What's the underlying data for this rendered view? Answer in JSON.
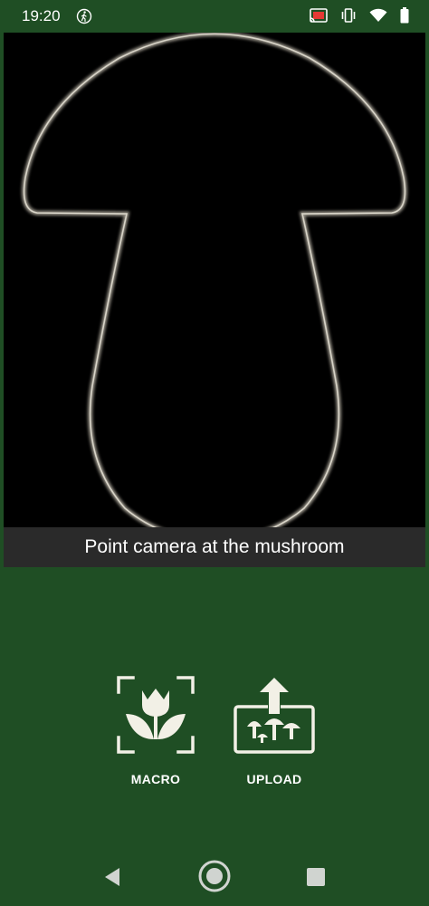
{
  "status_bar": {
    "time": "19:20",
    "icons": [
      "walk-icon",
      "cast-icon",
      "vibrate-icon",
      "wifi-icon",
      "battery-icon"
    ]
  },
  "camera": {
    "hint": "Point camera at the mushroom"
  },
  "actions": {
    "macro_label": "MACRO",
    "upload_label": "UPLOAD"
  },
  "nav": {
    "icons": [
      "back-icon",
      "home-icon",
      "recents-icon"
    ]
  },
  "colors": {
    "background": "#1f4e24",
    "camera_bg": "#000000",
    "hint_bg": "#2a2a2a",
    "icon": "#f2f0e6"
  }
}
